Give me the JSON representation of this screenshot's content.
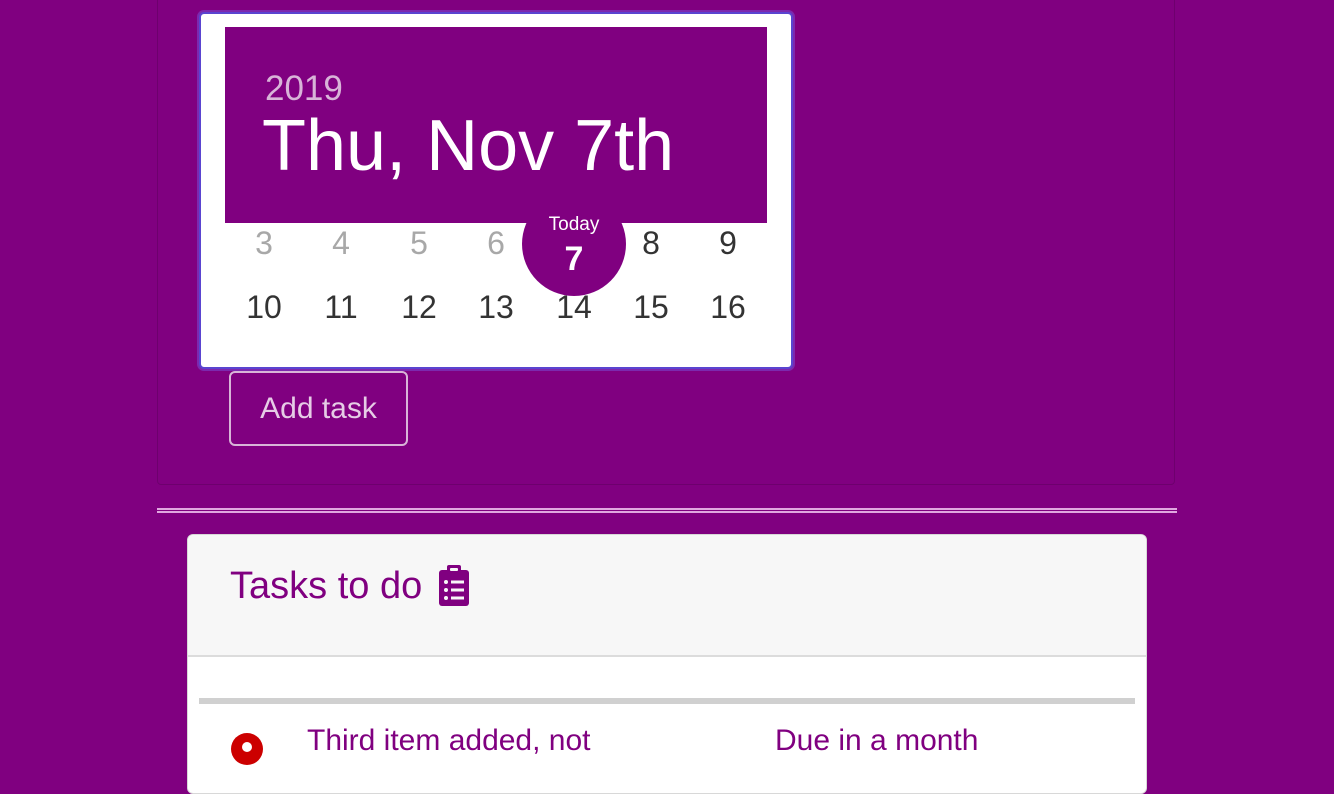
{
  "datepicker": {
    "year": "2019",
    "selected_date": "Thu, Nov 7th",
    "today_label": "Today",
    "week1": {
      "past_days": [
        "3",
        "4",
        "5",
        "6"
      ],
      "today": "7",
      "future_days": [
        "8",
        "9"
      ]
    },
    "week2": [
      "10",
      "11",
      "12",
      "13",
      "14",
      "15",
      "16"
    ]
  },
  "form": {
    "add_task_label": "Add task"
  },
  "tasks": {
    "title": "Tasks to do",
    "title_icon": "clipboard-list-icon",
    "items": [
      {
        "text": "Third item added, not",
        "due": "Due in a month",
        "status_icon": "alert-icon",
        "status_color": "#cc0000"
      }
    ]
  },
  "colors": {
    "brand": "#800080",
    "focus_ring": "#5a44d0",
    "alert": "#cc0000"
  }
}
